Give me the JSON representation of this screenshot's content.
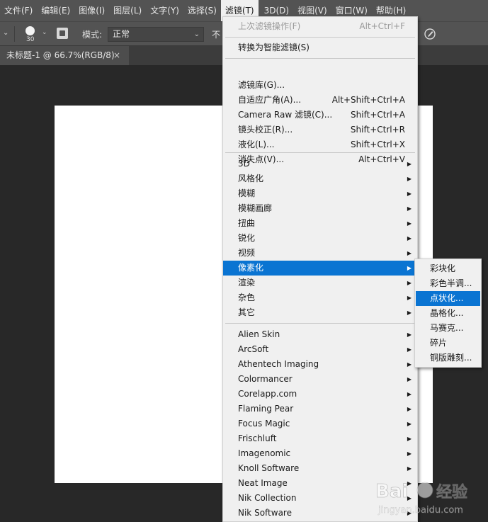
{
  "menubar": {
    "items": [
      "文件(F)",
      "编辑(E)",
      "图像(I)",
      "图层(L)",
      "文字(Y)",
      "选择(S)",
      "滤镜(T)",
      "3D(D)",
      "视图(V)",
      "窗口(W)",
      "帮助(H)"
    ],
    "active_index": 6
  },
  "options": {
    "brush_size": "30",
    "mode_label": "模式:",
    "mode_value": "正常",
    "opacity_label": "不"
  },
  "tab": {
    "title": "未标题-1 @ 66.7%(RGB/8)",
    "close": "×"
  },
  "filter_menu": {
    "last_filter": {
      "label": "上次滤镜操作(F)",
      "shortcut": "Alt+Ctrl+F"
    },
    "smart": {
      "label": "转换为智能滤镜(S)"
    },
    "group1": [
      {
        "label": "滤镜库(G)...",
        "shortcut": ""
      },
      {
        "label": "自适应广角(A)...",
        "shortcut": "Alt+Shift+Ctrl+A"
      },
      {
        "label": "Camera Raw 滤镜(C)...",
        "shortcut": "Shift+Ctrl+A"
      },
      {
        "label": "镜头校正(R)...",
        "shortcut": "Shift+Ctrl+R"
      },
      {
        "label": "液化(L)...",
        "shortcut": "Shift+Ctrl+X"
      },
      {
        "label": "消失点(V)...",
        "shortcut": "Alt+Ctrl+V"
      }
    ],
    "group2": [
      "3D",
      "风格化",
      "模糊",
      "模糊画廊",
      "扭曲",
      "锐化",
      "视频",
      "像素化",
      "渲染",
      "杂色",
      "其它"
    ],
    "group2_highlight": 7,
    "plugins": [
      "Alien Skin",
      "ArcSoft",
      "Athentech Imaging",
      "Colormancer",
      "Corelapp.com",
      "Flaming Pear",
      "Focus Magic",
      "Frischluft",
      "Imagenomic",
      "Knoll Software",
      "Neat Image",
      "Nik Collection",
      "Nik Software"
    ]
  },
  "submenu": {
    "items": [
      "彩块化",
      "彩色半调...",
      "点状化...",
      "晶格化...",
      "马赛克...",
      "碎片",
      "铜版雕刻..."
    ],
    "highlight": 2
  },
  "watermark": {
    "brand": "Bai",
    "brand_cn": "经验",
    "url": "jingyan.baidu.com"
  },
  "colors": {
    "highlight": "#0a74d2",
    "menu_bg": "#f0f0f0",
    "app_bg": "#282828"
  }
}
